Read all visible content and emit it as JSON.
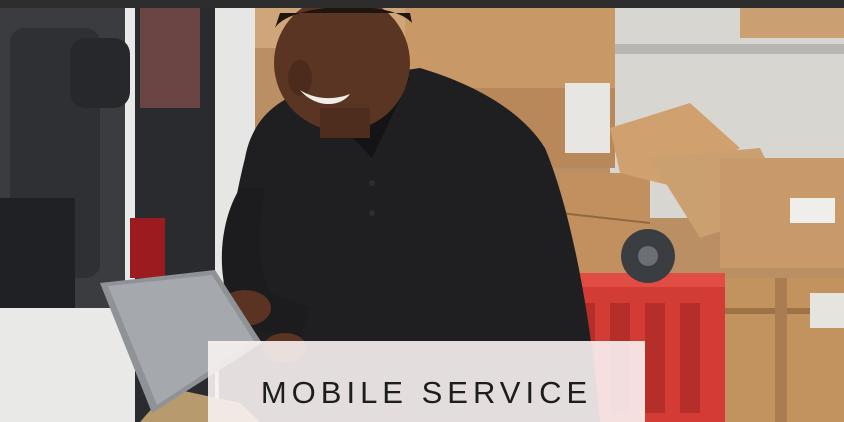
{
  "service_card": {
    "label": "MOBILE SERVICE",
    "photo_subject": "delivery-worker-with-tablet"
  },
  "colors": {
    "label_background": "#f8f2f2",
    "label_text": "#1d1d1d",
    "top_bar": "#2d2d2d"
  }
}
